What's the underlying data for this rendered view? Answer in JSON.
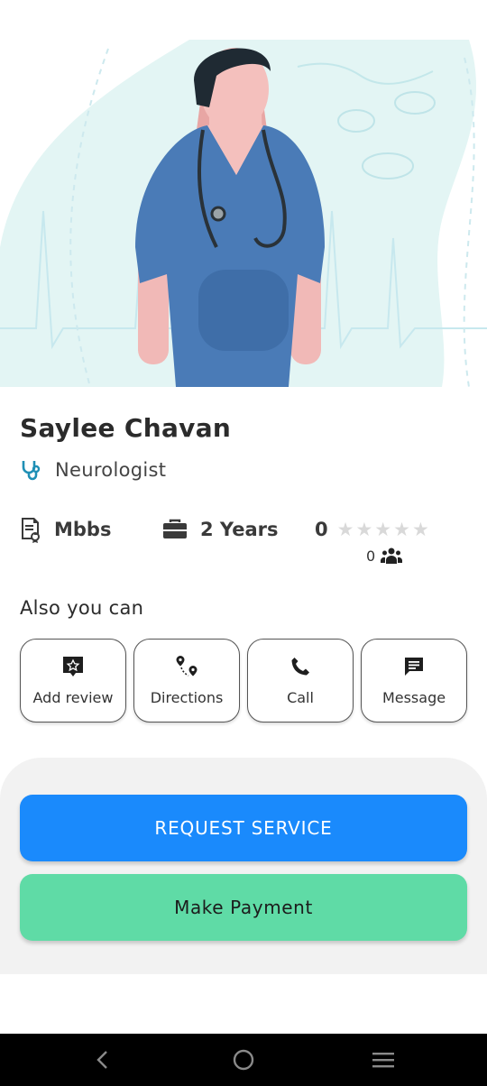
{
  "doctor": {
    "name": "Saylee Chavan",
    "specialty": "Neurologist",
    "qualification": "Mbbs",
    "experience": "2 Years",
    "rating": "0",
    "rating_max_stars": 5,
    "review_count": "0"
  },
  "actions": {
    "heading": "Also you can",
    "items": [
      {
        "label": "Add review",
        "icon": "add-review-icon"
      },
      {
        "label": "Directions",
        "icon": "directions-icon"
      },
      {
        "label": "Call",
        "icon": "phone-icon"
      },
      {
        "label": "Message",
        "icon": "message-icon"
      }
    ]
  },
  "buttons": {
    "request_service": "REQUEST SERVICE",
    "make_payment": "Make Payment"
  },
  "colors": {
    "primary_blue": "#1a8afc",
    "payment_green": "#5fdba6",
    "icon_teal": "#1f8fb5",
    "scrubs_blue": "#4a7bb7"
  },
  "system_nav": [
    "back",
    "home",
    "recents"
  ]
}
